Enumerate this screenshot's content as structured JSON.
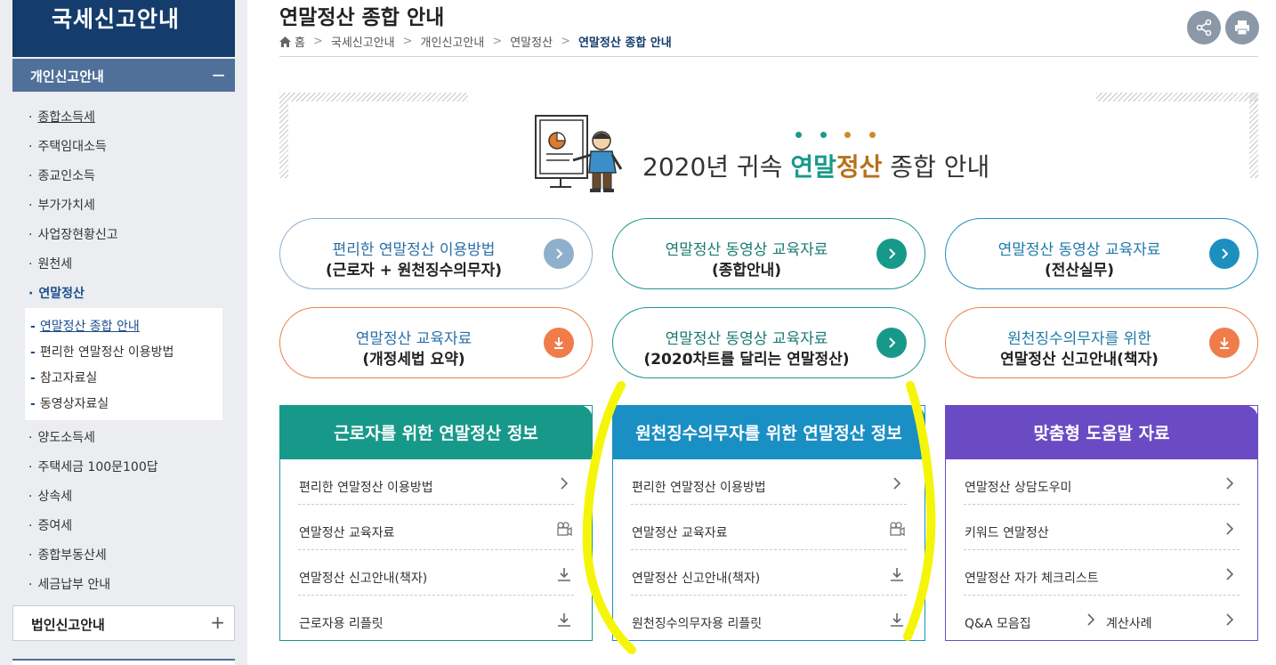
{
  "sidebar": {
    "title": "국세신고안내",
    "section": {
      "label": "개인신고안내",
      "toggle": "−"
    },
    "items_top": [
      {
        "label": "종합소득세"
      },
      {
        "label": "주택임대소득"
      },
      {
        "label": "종교인소득"
      },
      {
        "label": "부가가치세"
      },
      {
        "label": "사업장현황신고"
      },
      {
        "label": "원천세"
      },
      {
        "label": "연말정산"
      }
    ],
    "bullet": "·",
    "subitems": [
      {
        "label": "연말정산 종합 안내"
      },
      {
        "label": "편리한 연말정산 이용방법"
      },
      {
        "label": "참고자료실"
      },
      {
        "label": "동영상자료실"
      }
    ],
    "sub_dash": "-",
    "items_bottom": [
      {
        "label": "양도소득세"
      },
      {
        "label": "주택세금 100문100답"
      },
      {
        "label": "상속세"
      },
      {
        "label": "증여세"
      },
      {
        "label": "종합부동산세"
      },
      {
        "label": "세금납부 안내"
      }
    ],
    "corp": {
      "label": "법인신고안내",
      "toggle": "+"
    }
  },
  "header": {
    "title": "연말정산 종합 안내",
    "breadcrumb": [
      "홈",
      "국세신고안내",
      "개인신고안내",
      "연말정산",
      "연말정산 종합 안내"
    ],
    "sep": ">",
    "share_icon": "share-icon",
    "print_icon": "print-icon"
  },
  "banner": {
    "year_text": "2020년 귀속 ",
    "hl1": "연말",
    "hl2": "정산",
    "tail": " 종합 안내",
    "dot_colors": [
      "#1a9a8a",
      "#1a9a8a",
      "#d08a2a",
      "#d08a2a"
    ]
  },
  "pills": [
    {
      "line1": "편리한 연말정산 이용방법",
      "line2": "(근로자 + 원천징수의무자)",
      "icon": "chevron-right-icon",
      "color": "#8fb0cc",
      "text_color": "#2a6fa8"
    },
    {
      "line1": "연말정산 동영상 교육자료",
      "line2": "(종합안내)",
      "icon": "chevron-right-icon",
      "color": "#17998a",
      "text_color": "#1a7a72"
    },
    {
      "line1": "연말정산 동영상 교육자료",
      "line2": "(전산실무)",
      "icon": "chevron-right-icon",
      "color": "#1d8fbf",
      "text_color": "#1d7aa8"
    },
    {
      "line1": "연말정산 교육자료",
      "line2": "(개정세법 요약)",
      "icon": "download-icon",
      "color": "#f07c4a",
      "text_color": "#2a6fa8"
    },
    {
      "line1": "연말정산 동영상 교육자료",
      "line2": "(2020차트를 달리는 연말정산)",
      "icon": "chevron-right-icon",
      "color": "#17998a",
      "text_color": "#1a7a72"
    },
    {
      "line1": "원천징수의무자를 위한",
      "line2": "연말정산 신고안내(책자)",
      "icon": "download-icon",
      "color": "#f07c4a",
      "text_color": "#1d7aa8"
    }
  ],
  "cards": [
    {
      "title": "근로자를 위한 연말정산 정보",
      "color": "#17998a",
      "rows": [
        {
          "label": "편리한 연말정산 이용방법",
          "icon": "chevron-right-icon"
        },
        {
          "label": "연말정산 교육자료",
          "icon": "video-icon"
        },
        {
          "label": "연말정산 신고안내(책자)",
          "icon": "download-icon"
        },
        {
          "label": "근로자용 리플릿",
          "icon": "download-icon"
        }
      ]
    },
    {
      "title": "원천징수의무자를 위한 연말정산 정보",
      "color": "#1a8fc4",
      "rows": [
        {
          "label": "편리한 연말정산 이용방법",
          "icon": "chevron-right-icon"
        },
        {
          "label": "연말정산 교육자료",
          "icon": "video-icon"
        },
        {
          "label": "연말정산 신고안내(책자)",
          "icon": "download-icon"
        },
        {
          "label": "원천징수의무자용 리플릿",
          "icon": "download-icon"
        }
      ]
    },
    {
      "title": "맞춤형 도움말 자료",
      "color": "#6b4bc4",
      "rows": [
        {
          "label": "연말정산 상담도우미",
          "icon": "chevron-right-icon"
        },
        {
          "label": "키워드 연말정산",
          "icon": "chevron-right-icon"
        },
        {
          "label": "연말정산 자가 체크리스트",
          "icon": "chevron-right-icon"
        },
        {
          "label": "Q&A 모음집",
          "label2": "계산사례",
          "icon": "chevron-right-icon"
        }
      ]
    }
  ],
  "annotation_color": "#f5f50a"
}
